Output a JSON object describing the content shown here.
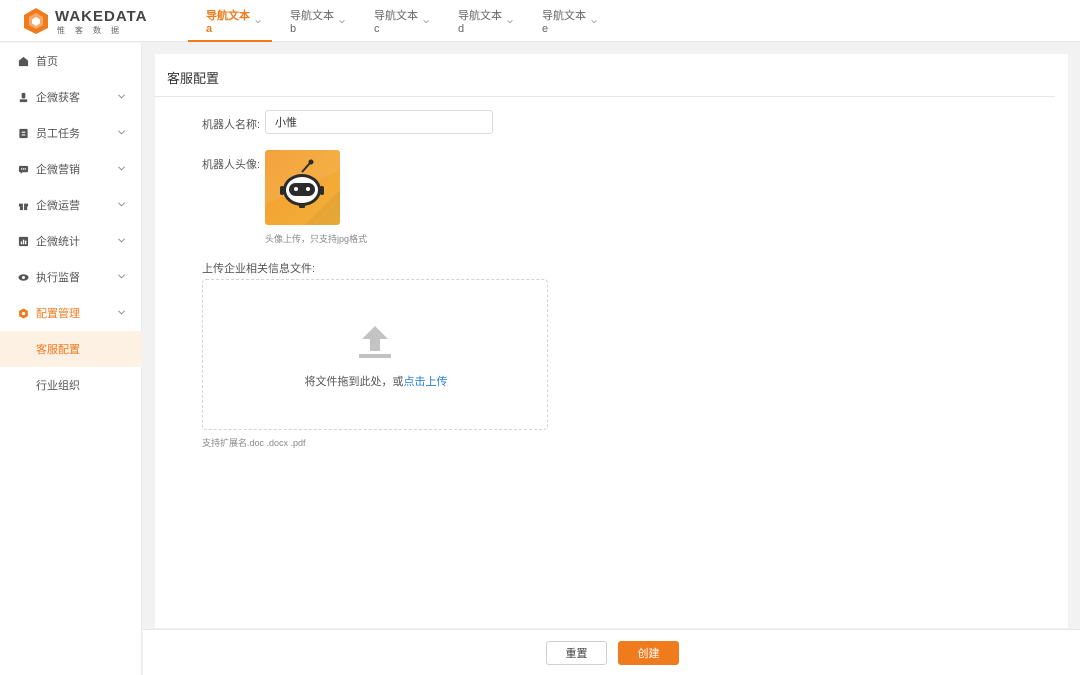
{
  "brand": {
    "name": "WAKEDATA",
    "subtitle": "惟客数据",
    "accent": "#f07b1d"
  },
  "nav": {
    "items": [
      {
        "label": "导航文本a",
        "active": true
      },
      {
        "label": "导航文本b",
        "active": false
      },
      {
        "label": "导航文本c",
        "active": false
      },
      {
        "label": "导航文本d",
        "active": false
      },
      {
        "label": "导航文本e",
        "active": false
      }
    ]
  },
  "sidebar": {
    "items": [
      {
        "label": "首页",
        "icon": "home-icon"
      },
      {
        "label": "企微获客",
        "icon": "user-plus-icon"
      },
      {
        "label": "员工任务",
        "icon": "task-icon"
      },
      {
        "label": "企微营销",
        "icon": "message-icon"
      },
      {
        "label": "企微运营",
        "icon": "gift-icon"
      },
      {
        "label": "企微统计",
        "icon": "stats-icon"
      },
      {
        "label": "执行监督",
        "icon": "eye-icon"
      },
      {
        "label": "配置管理",
        "icon": "settings-icon"
      }
    ],
    "subitems": [
      {
        "label": "客服配置",
        "active": true
      },
      {
        "label": "行业组织",
        "active": false
      }
    ]
  },
  "page": {
    "title": "客服配置",
    "robot_name_label": "机器人名称:",
    "robot_name_value": "小惟",
    "robot_avatar_label": "机器人头像:",
    "avatar_hint": "头像上传，只支持jpg格式",
    "upload_label": "上传企业相关信息文件:",
    "upload_text": "将文件拖到此处，或",
    "upload_link": "点击上传",
    "upload_hint": "支持扩展名.doc .docx .pdf"
  },
  "footer": {
    "reset_label": "重置",
    "create_label": "创建"
  }
}
